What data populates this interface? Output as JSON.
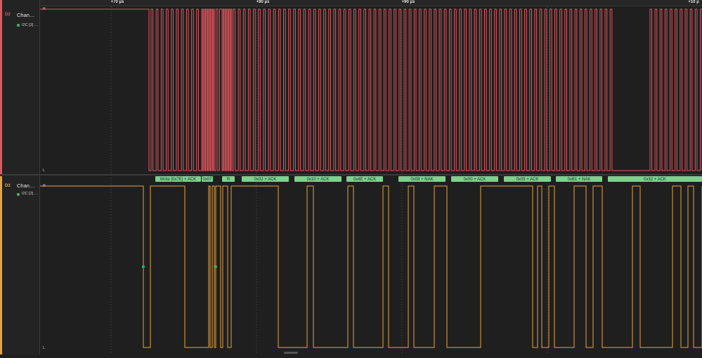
{
  "ruler": {
    "ticks": [
      {
        "label": "+70 µs"
      },
      {
        "label": "+80 µs"
      },
      {
        "label": "+90 µs"
      },
      {
        "label": "+10 µ"
      }
    ]
  },
  "channels": [
    {
      "id": "D2",
      "name": "Chan…",
      "analyzer": "I2C [2] …",
      "color": "#e0575e",
      "high": "H",
      "low": "L"
    },
    {
      "id": "D3",
      "name": "Chan…",
      "analyzer": "I2C [2] …",
      "color": "#e8a33d",
      "high": "H",
      "low": "L"
    }
  ],
  "decoded": [
    {
      "text": "Write [0x7E] + ACK"
    },
    {
      "text": "0x07"
    },
    {
      "text": "R"
    },
    {
      "text": "0x02 + ACK"
    },
    {
      "text": "0x10 + ACK"
    },
    {
      "text": "0x4E + ACK"
    },
    {
      "text": "0x08 + NAK"
    },
    {
      "text": "0x00 + ACK"
    },
    {
      "text": "0x05 + ACK"
    },
    {
      "text": "0xB1 + NAK"
    },
    {
      "text": "0x32 + ACK"
    }
  ],
  "colors": {
    "background": "#1f1f1f",
    "ch_d2": "#e0575e",
    "ch_d3": "#e8a33d",
    "decode_bubble": "#7fcf8f",
    "marker": "#2bb673"
  }
}
